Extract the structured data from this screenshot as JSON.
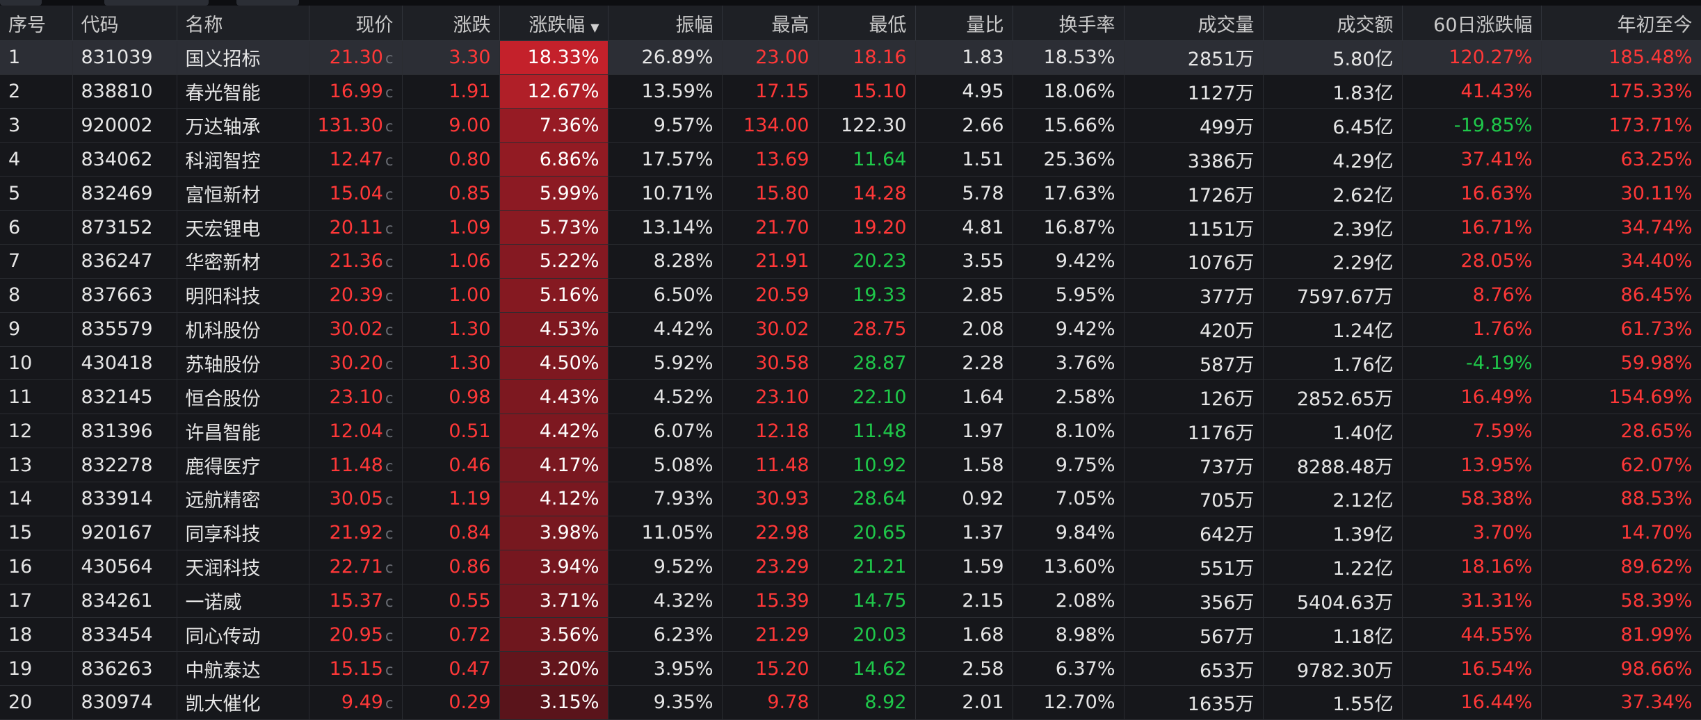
{
  "columns": {
    "seq": "序号",
    "code": "代码",
    "name": "名称",
    "price": "现价",
    "change": "涨跌",
    "pct": "涨跌幅",
    "amp": "振幅",
    "high": "最高",
    "low": "最低",
    "vr": "量比",
    "turnover": "换手率",
    "volume": "成交量",
    "amount": "成交额",
    "d60": "60日涨跌幅",
    "ytd": "年初至今"
  },
  "sort_indicator": "▼",
  "price_suffix": "c",
  "colors": {
    "up": "#ff3838",
    "down": "#1fc84a",
    "flat": "#e6e6e6",
    "pct_bg_max": "#c4212b",
    "pct_bg_min": "#5a141b",
    "header_bg": "#1e2025",
    "row_bg": "#16171b",
    "selected_row_bg": "#2c2e35"
  },
  "rows": [
    {
      "seq": "1",
      "code": "831039",
      "name": "国义招标",
      "price": "21.30",
      "change": "3.30",
      "pct": "18.33%",
      "amp": "26.89%",
      "high": "23.00",
      "low": "18.16",
      "vr": "1.83",
      "turnover": "18.53%",
      "volume": "2851万",
      "amount": "5.80亿",
      "d60": "120.27%",
      "ytd": "185.48%",
      "high_dir": "up",
      "low_dir": "up",
      "d60_dir": "up",
      "ytd_dir": "up",
      "pct_value": 18.33
    },
    {
      "seq": "2",
      "code": "838810",
      "name": "春光智能",
      "price": "16.99",
      "change": "1.91",
      "pct": "12.67%",
      "amp": "13.59%",
      "high": "17.15",
      "low": "15.10",
      "vr": "4.95",
      "turnover": "18.06%",
      "volume": "1127万",
      "amount": "1.83亿",
      "d60": "41.43%",
      "ytd": "175.33%",
      "high_dir": "up",
      "low_dir": "up",
      "d60_dir": "up",
      "ytd_dir": "up",
      "pct_value": 12.67
    },
    {
      "seq": "3",
      "code": "920002",
      "name": "万达轴承",
      "price": "131.30",
      "change": "9.00",
      "pct": "7.36%",
      "amp": "9.57%",
      "high": "134.00",
      "low": "122.30",
      "vr": "2.66",
      "turnover": "15.66%",
      "volume": "499万",
      "amount": "6.45亿",
      "d60": "-19.85%",
      "ytd": "173.71%",
      "high_dir": "up",
      "low_dir": "flat",
      "d60_dir": "down",
      "ytd_dir": "up",
      "pct_value": 7.36
    },
    {
      "seq": "4",
      "code": "834062",
      "name": "科润智控",
      "price": "12.47",
      "change": "0.80",
      "pct": "6.86%",
      "amp": "17.57%",
      "high": "13.69",
      "low": "11.64",
      "vr": "1.51",
      "turnover": "25.36%",
      "volume": "3386万",
      "amount": "4.29亿",
      "d60": "37.41%",
      "ytd": "63.25%",
      "high_dir": "up",
      "low_dir": "down",
      "d60_dir": "up",
      "ytd_dir": "up",
      "pct_value": 6.86
    },
    {
      "seq": "5",
      "code": "832469",
      "name": "富恒新材",
      "price": "15.04",
      "change": "0.85",
      "pct": "5.99%",
      "amp": "10.71%",
      "high": "15.80",
      "low": "14.28",
      "vr": "5.78",
      "turnover": "17.63%",
      "volume": "1726万",
      "amount": "2.62亿",
      "d60": "16.63%",
      "ytd": "30.11%",
      "high_dir": "up",
      "low_dir": "up",
      "d60_dir": "up",
      "ytd_dir": "up",
      "pct_value": 5.99
    },
    {
      "seq": "6",
      "code": "873152",
      "name": "天宏锂电",
      "price": "20.11",
      "change": "1.09",
      "pct": "5.73%",
      "amp": "13.14%",
      "high": "21.70",
      "low": "19.20",
      "vr": "4.81",
      "turnover": "16.87%",
      "volume": "1151万",
      "amount": "2.39亿",
      "d60": "16.71%",
      "ytd": "34.74%",
      "high_dir": "up",
      "low_dir": "up",
      "d60_dir": "up",
      "ytd_dir": "up",
      "pct_value": 5.73
    },
    {
      "seq": "7",
      "code": "836247",
      "name": "华密新材",
      "price": "21.36",
      "change": "1.06",
      "pct": "5.22%",
      "amp": "8.28%",
      "high": "21.91",
      "low": "20.23",
      "vr": "3.55",
      "turnover": "9.42%",
      "volume": "1076万",
      "amount": "2.29亿",
      "d60": "28.05%",
      "ytd": "34.40%",
      "high_dir": "up",
      "low_dir": "down",
      "d60_dir": "up",
      "ytd_dir": "up",
      "pct_value": 5.22
    },
    {
      "seq": "8",
      "code": "837663",
      "name": "明阳科技",
      "price": "20.39",
      "change": "1.00",
      "pct": "5.16%",
      "amp": "6.50%",
      "high": "20.59",
      "low": "19.33",
      "vr": "2.85",
      "turnover": "5.95%",
      "volume": "377万",
      "amount": "7597.67万",
      "d60": "8.76%",
      "ytd": "86.45%",
      "high_dir": "up",
      "low_dir": "down",
      "d60_dir": "up",
      "ytd_dir": "up",
      "pct_value": 5.16
    },
    {
      "seq": "9",
      "code": "835579",
      "name": "机科股份",
      "price": "30.02",
      "change": "1.30",
      "pct": "4.53%",
      "amp": "4.42%",
      "high": "30.02",
      "low": "28.75",
      "vr": "2.08",
      "turnover": "9.42%",
      "volume": "420万",
      "amount": "1.24亿",
      "d60": "1.76%",
      "ytd": "61.73%",
      "high_dir": "up",
      "low_dir": "up",
      "d60_dir": "up",
      "ytd_dir": "up",
      "pct_value": 4.53
    },
    {
      "seq": "10",
      "code": "430418",
      "name": "苏轴股份",
      "price": "30.20",
      "change": "1.30",
      "pct": "4.50%",
      "amp": "5.92%",
      "high": "30.58",
      "low": "28.87",
      "vr": "2.28",
      "turnover": "3.76%",
      "volume": "587万",
      "amount": "1.76亿",
      "d60": "-4.19%",
      "ytd": "59.98%",
      "high_dir": "up",
      "low_dir": "down",
      "d60_dir": "down",
      "ytd_dir": "up",
      "pct_value": 4.5
    },
    {
      "seq": "11",
      "code": "832145",
      "name": "恒合股份",
      "price": "23.10",
      "change": "0.98",
      "pct": "4.43%",
      "amp": "4.52%",
      "high": "23.10",
      "low": "22.10",
      "vr": "1.64",
      "turnover": "2.58%",
      "volume": "126万",
      "amount": "2852.65万",
      "d60": "16.49%",
      "ytd": "154.69%",
      "high_dir": "up",
      "low_dir": "down",
      "d60_dir": "up",
      "ytd_dir": "up",
      "pct_value": 4.43
    },
    {
      "seq": "12",
      "code": "831396",
      "name": "许昌智能",
      "price": "12.04",
      "change": "0.51",
      "pct": "4.42%",
      "amp": "6.07%",
      "high": "12.18",
      "low": "11.48",
      "vr": "1.97",
      "turnover": "8.10%",
      "volume": "1176万",
      "amount": "1.40亿",
      "d60": "7.59%",
      "ytd": "28.65%",
      "high_dir": "up",
      "low_dir": "down",
      "d60_dir": "up",
      "ytd_dir": "up",
      "pct_value": 4.42
    },
    {
      "seq": "13",
      "code": "832278",
      "name": "鹿得医疗",
      "price": "11.48",
      "change": "0.46",
      "pct": "4.17%",
      "amp": "5.08%",
      "high": "11.48",
      "low": "10.92",
      "vr": "1.58",
      "turnover": "9.75%",
      "volume": "737万",
      "amount": "8288.48万",
      "d60": "13.95%",
      "ytd": "62.07%",
      "high_dir": "up",
      "low_dir": "down",
      "d60_dir": "up",
      "ytd_dir": "up",
      "pct_value": 4.17
    },
    {
      "seq": "14",
      "code": "833914",
      "name": "远航精密",
      "price": "30.05",
      "change": "1.19",
      "pct": "4.12%",
      "amp": "7.93%",
      "high": "30.93",
      "low": "28.64",
      "vr": "0.92",
      "turnover": "7.05%",
      "volume": "705万",
      "amount": "2.12亿",
      "d60": "58.38%",
      "ytd": "88.53%",
      "high_dir": "up",
      "low_dir": "down",
      "d60_dir": "up",
      "ytd_dir": "up",
      "pct_value": 4.12
    },
    {
      "seq": "15",
      "code": "920167",
      "name": "同享科技",
      "price": "21.92",
      "change": "0.84",
      "pct": "3.98%",
      "amp": "11.05%",
      "high": "22.98",
      "low": "20.65",
      "vr": "1.37",
      "turnover": "9.84%",
      "volume": "642万",
      "amount": "1.39亿",
      "d60": "3.70%",
      "ytd": "14.70%",
      "high_dir": "up",
      "low_dir": "down",
      "d60_dir": "up",
      "ytd_dir": "up",
      "pct_value": 3.98
    },
    {
      "seq": "16",
      "code": "430564",
      "name": "天润科技",
      "price": "22.71",
      "change": "0.86",
      "pct": "3.94%",
      "amp": "9.52%",
      "high": "23.29",
      "low": "21.21",
      "vr": "1.59",
      "turnover": "13.60%",
      "volume": "551万",
      "amount": "1.22亿",
      "d60": "18.16%",
      "ytd": "89.62%",
      "high_dir": "up",
      "low_dir": "down",
      "d60_dir": "up",
      "ytd_dir": "up",
      "pct_value": 3.94
    },
    {
      "seq": "17",
      "code": "834261",
      "name": "一诺威",
      "price": "15.37",
      "change": "0.55",
      "pct": "3.71%",
      "amp": "4.32%",
      "high": "15.39",
      "low": "14.75",
      "vr": "2.15",
      "turnover": "2.08%",
      "volume": "356万",
      "amount": "5404.63万",
      "d60": "31.31%",
      "ytd": "58.39%",
      "high_dir": "up",
      "low_dir": "down",
      "d60_dir": "up",
      "ytd_dir": "up",
      "pct_value": 3.71
    },
    {
      "seq": "18",
      "code": "833454",
      "name": "同心传动",
      "price": "20.95",
      "change": "0.72",
      "pct": "3.56%",
      "amp": "6.23%",
      "high": "21.29",
      "low": "20.03",
      "vr": "1.68",
      "turnover": "8.98%",
      "volume": "567万",
      "amount": "1.18亿",
      "d60": "44.55%",
      "ytd": "81.99%",
      "high_dir": "up",
      "low_dir": "down",
      "d60_dir": "up",
      "ytd_dir": "up",
      "pct_value": 3.56
    },
    {
      "seq": "19",
      "code": "836263",
      "name": "中航泰达",
      "price": "15.15",
      "change": "0.47",
      "pct": "3.20%",
      "amp": "3.95%",
      "high": "15.20",
      "low": "14.62",
      "vr": "2.58",
      "turnover": "6.37%",
      "volume": "653万",
      "amount": "9782.30万",
      "d60": "16.54%",
      "ytd": "98.66%",
      "high_dir": "up",
      "low_dir": "down",
      "d60_dir": "up",
      "ytd_dir": "up",
      "pct_value": 3.2
    },
    {
      "seq": "20",
      "code": "830974",
      "name": "凯大催化",
      "price": "9.49",
      "change": "0.29",
      "pct": "3.15%",
      "amp": "9.35%",
      "high": "9.78",
      "low": "8.92",
      "vr": "2.01",
      "turnover": "12.70%",
      "volume": "1635万",
      "amount": "1.55亿",
      "d60": "16.44%",
      "ytd": "37.34%",
      "high_dir": "up",
      "low_dir": "down",
      "d60_dir": "up",
      "ytd_dir": "up",
      "pct_value": 3.15
    }
  ]
}
